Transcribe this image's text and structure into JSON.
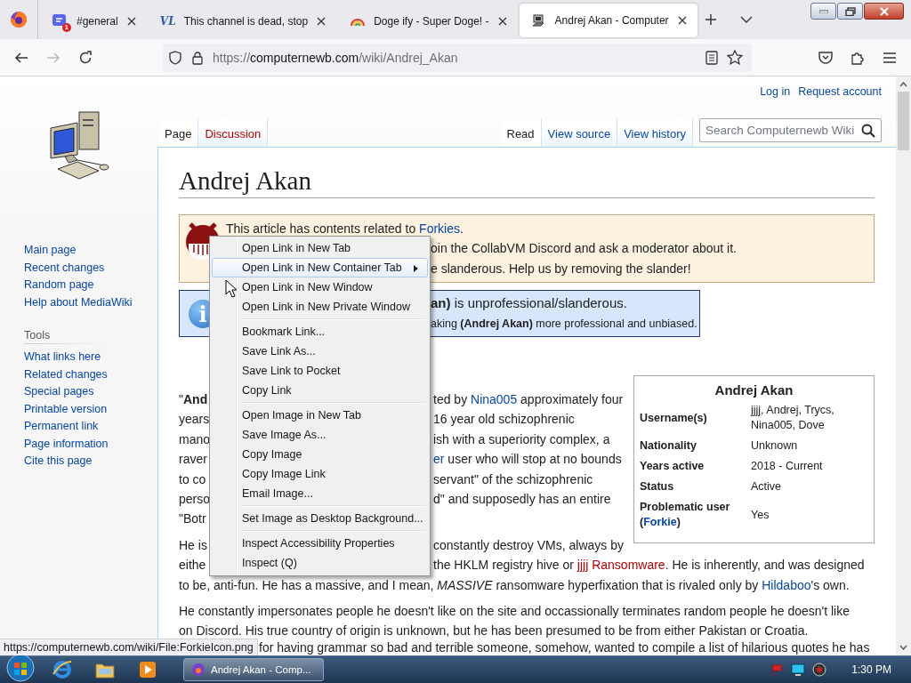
{
  "browser": {
    "tabs": [
      {
        "title": "#general",
        "kind": "chat",
        "badge": "1",
        "selected": false
      },
      {
        "title": "This channel is dead, stop",
        "kind": "letters",
        "icon_text": "VL",
        "selected": false
      },
      {
        "title": "Doge ify - Super Doge! -",
        "kind": "rainbow",
        "selected": false
      },
      {
        "title": "Andrej Akan - Computer",
        "kind": "computer",
        "selected": true
      }
    ],
    "url": {
      "scheme": "https://",
      "host": "computernewb.com",
      "path": "/wiki/Andrej_Akan"
    }
  },
  "wiki": {
    "personal": [
      "Log in",
      "Request account"
    ],
    "left_tabs": [
      {
        "label": "Page",
        "selected": true,
        "missing": false
      },
      {
        "label": "Discussion",
        "selected": false,
        "missing": true
      }
    ],
    "right_tabs": [
      {
        "label": "Read",
        "selected": true
      },
      {
        "label": "View source",
        "selected": false
      },
      {
        "label": "View history",
        "selected": false
      }
    ],
    "search": {
      "placeholder": "Search Computernewb Wiki"
    },
    "navigation": [
      "Main page",
      "Recent changes",
      "Random page",
      "Help about MediaWiki"
    ],
    "tools": {
      "heading": "Tools",
      "items": [
        "What links here",
        "Related changes",
        "Special pages",
        "Printable version",
        "Permanent link",
        "Page information",
        "Cite this page"
      ]
    },
    "title": "Andrej Akan",
    "notices": [
      {
        "kind": "warning",
        "lines": [
          {
            "kind": "full",
            "left": [
              {
                "kind": "text",
                "text": "This article has contents related to "
              },
              {
                "kind": "link",
                "text": "Forkies"
              },
              {
                "kind": "text",
                "text": "."
              }
            ]
          },
          {
            "kind": "after-menu",
            "right": [
              {
                "kind": "text",
                "text": "oin the CollabVM Discord and ask a moderator about it."
              }
            ]
          },
          {
            "kind": "after-menu",
            "right": [
              {
                "kind": "text",
                "text": "e slanderous. Help us by removing the slander!"
              }
            ]
          }
        ]
      },
      {
        "kind": "info",
        "icon_text": "i",
        "lines": [
          {
            "kind": "after-menu",
            "right": [
              {
                "kind": "bold",
                "text": "an)"
              },
              {
                "kind": "text",
                "text": " is unprofessional/slanderous."
              }
            ]
          },
          {
            "kind": "after-menu-small",
            "right": [
              {
                "kind": "text",
                "text": "aking "
              },
              {
                "kind": "bold",
                "text": "(Andrej Akan)"
              },
              {
                "kind": "text",
                "text": " more professional and unbiased."
              }
            ]
          }
        ]
      }
    ],
    "infobox": {
      "title": "Andrej Akan",
      "rows": [
        {
          "label": "Username(s)",
          "value": "jjjj, Andrej, Trycs, Nina005, Dove"
        },
        {
          "label": "Nationality",
          "value": "Unknown"
        },
        {
          "label": "Years active",
          "value": "2018 - Current"
        },
        {
          "label": "Status",
          "value": "Active"
        },
        {
          "label": "Problematic user",
          "label_extra": [
            {
              "kind": "text",
              "text": "("
            },
            {
              "kind": "link",
              "text": "Forkie"
            },
            {
              "kind": "text",
              "text": ")"
            }
          ],
          "value": "Yes"
        }
      ]
    },
    "paragraphs": [
      {
        "lines": [
          {
            "kind": "split",
            "left": [
              {
                "kind": "text",
                "text": "\""
              },
              {
                "kind": "bold",
                "text": "And"
              }
            ],
            "right": [
              {
                "kind": "text",
                "text": "ted by "
              },
              {
                "kind": "link",
                "text": "Nina005"
              },
              {
                "kind": "text",
                "text": " approximately four"
              }
            ]
          },
          {
            "kind": "split",
            "left": [
              {
                "kind": "text",
                "text": "years"
              }
            ],
            "right": [
              {
                "kind": "text",
                "text": "16 year old schizophrenic"
              }
            ]
          },
          {
            "kind": "split",
            "left": [
              {
                "kind": "text",
                "text": "mano"
              }
            ],
            "right": [
              {
                "kind": "text",
                "text": "ish with a superiority complex, a"
              }
            ]
          },
          {
            "kind": "split",
            "left": [
              {
                "kind": "text",
                "text": "raver"
              }
            ],
            "right": [
              {
                "kind": "link",
                "text": "er"
              },
              {
                "kind": "text",
                "text": " user who will stop at no bounds"
              }
            ]
          },
          {
            "kind": "split",
            "left": [
              {
                "kind": "text",
                "text": "to co"
              }
            ],
            "right": [
              {
                "kind": "text",
                "text": "servant\" of the schizophrenic"
              }
            ]
          },
          {
            "kind": "split",
            "left": [
              {
                "kind": "text",
                "text": "perso"
              }
            ],
            "right": [
              {
                "kind": "text",
                "text": "d\" and supposedly has an entire"
              }
            ]
          },
          {
            "kind": "full",
            "left": [
              {
                "kind": "text",
                "text": "\"Botr"
              }
            ]
          }
        ]
      },
      {
        "lines": [
          {
            "kind": "split",
            "left": [
              {
                "kind": "text",
                "text": "He is"
              }
            ],
            "right": [
              {
                "kind": "text",
                "text": "constantly destroy VMs, always by"
              }
            ]
          },
          {
            "kind": "split",
            "left": [
              {
                "kind": "text",
                "text": "eithe"
              }
            ],
            "right": [
              {
                "kind": "text",
                "text": "the HKLM registry hive or "
              },
              {
                "kind": "redlink",
                "text": "jjjj Ransomware"
              },
              {
                "kind": "text",
                "text": ". He is inherently, and was designed"
              }
            ]
          },
          {
            "kind": "full",
            "left": [
              {
                "kind": "text",
                "text": "to be, anti-fun. He has a massive, and I mean, "
              },
              {
                "kind": "italic",
                "text": "MASSIVE"
              },
              {
                "kind": "text",
                "text": " ransomware hyperfixation that is rivaled only by "
              },
              {
                "kind": "link",
                "text": "Hildaboo"
              },
              {
                "kind": "text",
                "text": "'s own."
              }
            ]
          }
        ]
      },
      {
        "lines": [
          {
            "kind": "full",
            "left": [
              {
                "kind": "text",
                "text": "He constantly impersonates people he doesn't like on the site and occassionally terminates random people he doesn't like"
              }
            ]
          },
          {
            "kind": "full",
            "left": [
              {
                "kind": "text",
                "text": "on Discord. His true country of origin is unknown, but he has been presumed to be from either Pakistan or Croatia."
              }
            ]
          }
        ]
      },
      {
        "lines": [
          {
            "kind": "after-tip",
            "right": [
              {
                "kind": "text",
                "text": "for having grammar so bad and terrible someone, somehow, wanted to compile a list of hilarious quotes he has"
              }
            ]
          }
        ]
      }
    ]
  },
  "context_menu": {
    "groups": [
      [
        {
          "label": "Open Link in New Tab",
          "highlighted": false,
          "submenu": false
        },
        {
          "label": "Open Link in New Container Tab",
          "highlighted": true,
          "submenu": true
        },
        {
          "label": "Open Link in New Window",
          "highlighted": false,
          "submenu": false
        },
        {
          "label": "Open Link in New Private Window",
          "highlighted": false,
          "submenu": false
        }
      ],
      [
        {
          "label": "Bookmark Link...",
          "highlighted": false,
          "submenu": false
        },
        {
          "label": "Save Link As...",
          "highlighted": false,
          "submenu": false
        },
        {
          "label": "Save Link to Pocket",
          "highlighted": false,
          "submenu": false
        },
        {
          "label": "Copy Link",
          "highlighted": false,
          "submenu": false
        }
      ],
      [
        {
          "label": "Open Image in New Tab",
          "highlighted": false,
          "submenu": false
        },
        {
          "label": "Save Image As...",
          "highlighted": false,
          "submenu": false
        },
        {
          "label": "Copy Image",
          "highlighted": false,
          "submenu": false
        },
        {
          "label": "Copy Image Link",
          "highlighted": false,
          "submenu": false
        },
        {
          "label": "Email Image...",
          "highlighted": false,
          "submenu": false
        }
      ],
      [
        {
          "label": "Set Image as Desktop Background...",
          "highlighted": false,
          "submenu": false
        }
      ],
      [
        {
          "label": "Inspect Accessibility Properties",
          "highlighted": false,
          "submenu": false
        },
        {
          "label": "Inspect (Q)",
          "highlighted": false,
          "submenu": false
        }
      ]
    ]
  },
  "status_tip": "https://computernewb.com/wiki/File:ForkieIcon.png",
  "taskbar": {
    "task": "Andrej Akan - Comp...",
    "clock": "1:30 PM"
  }
}
